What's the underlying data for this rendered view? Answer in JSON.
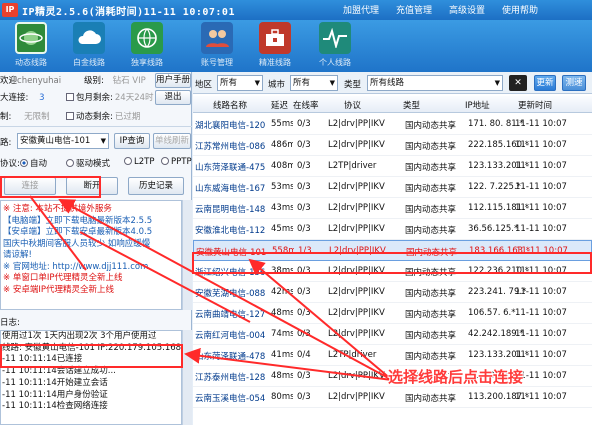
{
  "app": {
    "logo": "IP",
    "title": "IP精灵2.5.6(消耗时间)11-11 10:07:01",
    "menu": [
      "加盟代理",
      "充值管理",
      "高级设置",
      "使用帮助"
    ]
  },
  "toolbar": [
    {
      "label": "动态线路",
      "icon": "planet-icon",
      "color": "#2f8a3a"
    },
    {
      "label": "白金线路",
      "icon": "cloud-icon",
      "color": "#1a7fb5"
    },
    {
      "label": "独享线路",
      "icon": "globe-icon",
      "color": "#2a9a4a"
    },
    {
      "label": "账号管理",
      "icon": "users-icon",
      "color": "#2a6ab5"
    },
    {
      "label": "精准线路",
      "icon": "toolbox-icon",
      "color": "#c0392b"
    },
    {
      "label": "个人线路",
      "icon": "pulse-icon",
      "color": "#1f8a7a"
    }
  ],
  "account": {
    "user_prefix": "欢迎",
    "username": "chenyuhai",
    "level_label": "级别:",
    "level_value": "钻石 VIP",
    "conn_label": "大连接:",
    "conn_value": "3",
    "monthly_label": "包月剩余:",
    "monthly_value": "24天24时",
    "limit_label": "制:",
    "limit_value": "无限制",
    "dynamic_label": "动态剩余:",
    "dynamic_value": "已过期",
    "manual_button": "用户手册",
    "logout_button": "退出"
  },
  "connection": {
    "route_label": "路:",
    "route_value": "安徽黄山电信-101",
    "ip_query_button": "IP查询",
    "single_refresh_button": "单线刷新",
    "protocol_label": "协议:",
    "modes": [
      {
        "label": "自动",
        "checked": true
      },
      {
        "label": "驱动模式",
        "checked": false
      },
      {
        "label": "L2TP",
        "checked": false
      },
      {
        "label": "PPTP",
        "checked": false
      }
    ],
    "connect_button": "连接",
    "disconnect_button": "断开",
    "history_button": "历史记录"
  },
  "notices": [
    {
      "text": "※ 注意:  本站不提供境外服务",
      "color": "#d11"
    },
    {
      "text": "【电脑端】立即下载电脑最新版本2.5.5",
      "color": "#1a5fb4"
    },
    {
      "text": "【安卓端】立即下载安卓最新版本4.0.5",
      "color": "#1a5fb4"
    },
    {
      "text": "国庆中秋期间客服人员较少,如响应缓慢",
      "color": "#1a5fb4"
    },
    {
      "text": "请谅解!",
      "color": "#1a5fb4"
    },
    {
      "text": "※ 官网地址: http://www.djj111.com",
      "color": "#1a5fb4"
    },
    {
      "text": "※ 单窗口单IP代理精灵全新上线",
      "color": "#d11"
    },
    {
      "text": "※ 安卓端IP代理精灵全新上线",
      "color": "#d11"
    }
  ],
  "log": {
    "title": "日志:",
    "lines": [
      "使用过1次 1天内出现2次 3个用户使用过",
      "线路: 安徽黄山电信-101 IP:220.179.105.168",
      "-11 10:11:14已连接",
      "-11 10:11:14会话建立成功...",
      "-11 10:11:14开始建立会话",
      "-11 10:11:14用户身份验证",
      "-11 10:11:14检查网络连接"
    ]
  },
  "filters": {
    "region_label": "地区",
    "region_value": "所有",
    "city_label": "城市",
    "city_value": "所有",
    "type_label": "类型",
    "type_value": "所有线路",
    "refresh_button": "更新",
    "test_button": "测速"
  },
  "table": {
    "columns": [
      "线路名称",
      "延迟",
      "在线率",
      "协议",
      "类型",
      "IP地址",
      "更新时间"
    ],
    "rows": [
      [
        "湖北襄阳电信-120",
        "55ms",
        "0/3",
        "L2|drv|PP|IKV",
        "国内动态共享",
        "171. 80. 81.*",
        "11-11 10:07"
      ],
      [
        "江苏常州电信-086",
        "486ms",
        "0/3",
        "L2|drv|PP|IKV",
        "国内动态共享",
        "222.185.160.*",
        "11-11 10:07"
      ],
      [
        "山东菏泽联通-475",
        "408ms",
        "0/3",
        "L2TP|driver",
        "国内动态共享",
        "123.133.201.*",
        "11-11 10:07"
      ],
      [
        "山东威海电信-167",
        "53ms",
        "0/3",
        "L2|drv|PP|IKV",
        "国内动态共享",
        "122. 7.225.*",
        "11-11 10:07"
      ],
      [
        "云南昆明电信-148",
        "43ms",
        "0/3",
        "L2|drv|PP|IKV",
        "国内动态共享",
        "112.115.181.*",
        "11-11 10:07"
      ],
      [
        "安徽淮北电信-112",
        "45ms",
        "0/3",
        "L2|drv|PP|IKV",
        "国内动态共享",
        "36.56.125.*",
        "11-11 10:07"
      ],
      [
        "安徽黄山电信-101",
        "558ms",
        "1/3",
        "L2|drv|PP|IKV",
        "国内动态共享",
        "183.166.163.*",
        "11-11 10:07"
      ],
      [
        "浙江绍兴电信-156",
        "38ms",
        "0/3",
        "L2|drv|PP|IKV",
        "国内动态共享",
        "122.236.210.*",
        "11-11 10:07"
      ],
      [
        "安徽芜湖电信-088",
        "42ms",
        "0/3",
        "L2|drv|PP|IKV",
        "国内动态共享",
        "223.241. 79.*",
        "11-11 10:07"
      ],
      [
        "云南曲靖电信-127",
        "48ms",
        "0/3",
        "L2|drv|PP|IKV",
        "国内动态共享",
        "106.57. 6.*",
        "11-11 10:07"
      ],
      [
        "云南红河电信-004",
        "74ms",
        "0/3",
        "L2|drv|PP|IKV",
        "国内动态共享",
        "42.242.189.*",
        "11-11 10:07"
      ],
      [
        "山东菏泽联通-478",
        "41ms",
        "0/4",
        "L2TP|driver",
        "国内动态共享",
        "123.133.201.*",
        "11-11 10:07"
      ],
      [
        "江苏泰州电信-128",
        "48ms",
        "0/3",
        "L2|drv|PP|IKV",
        "国内动态共享",
        "117. 94. 69.*",
        "11-11 10:07"
      ],
      [
        "云南玉溪电信-054",
        "80ms",
        "0/3",
        "L2|drv|PP|IKV",
        "国内动态共享",
        "113.200.187.*",
        "11-11 10:07"
      ]
    ],
    "selected_index": 6
  },
  "annotation": {
    "text": "选择线路后点击连接",
    "color": "#ff2a2a"
  }
}
